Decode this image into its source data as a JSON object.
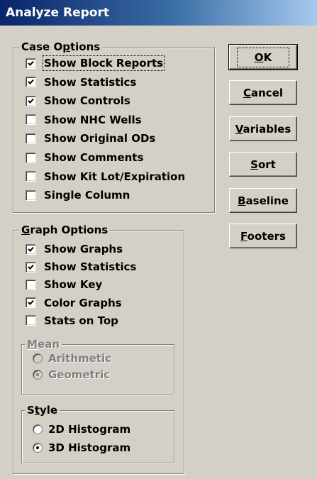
{
  "window": {
    "title": "Analyze Report"
  },
  "case_options": {
    "legend_pre": "Case O",
    "legend_u": "p",
    "legend_post": "tions",
    "items": [
      {
        "label": "Show Block Reports",
        "checked": true
      },
      {
        "label": "Show Statistics",
        "checked": true
      },
      {
        "label": "Show Controls",
        "checked": true
      },
      {
        "label": "Show NHC Wells",
        "checked": false
      },
      {
        "label": "Show Original ODs",
        "checked": false
      },
      {
        "label": "Show Comments",
        "checked": false
      },
      {
        "label": "Show Kit Lot/Expiration",
        "checked": false
      },
      {
        "label": "Single Column",
        "checked": false
      }
    ]
  },
  "graph_options": {
    "legend_u": "G",
    "legend_post": "raph Options",
    "items": [
      {
        "label": "Show Graphs",
        "checked": true
      },
      {
        "label": "Show Statistics",
        "checked": true
      },
      {
        "label": "Show Key",
        "checked": false
      },
      {
        "label": "Color Graphs",
        "checked": true
      },
      {
        "label": "Stats on Top",
        "checked": false
      }
    ],
    "mean": {
      "legend_u": "M",
      "legend_post": "ean",
      "options": [
        {
          "label": "Arithmetic",
          "selected": false
        },
        {
          "label": "Geometric",
          "selected": true
        }
      ]
    },
    "style": {
      "legend_pre": "S",
      "legend_u": "t",
      "legend_post": "yle",
      "options": [
        {
          "label": "2D Histogram",
          "selected": false
        },
        {
          "label": "3D Histogram",
          "selected": true
        }
      ]
    }
  },
  "buttons": {
    "ok": {
      "u": "O",
      "rest": "K"
    },
    "cancel": {
      "u": "C",
      "rest": "ancel"
    },
    "variables": {
      "u": "V",
      "rest": "ariables"
    },
    "sort": {
      "u": "S",
      "rest": "ort"
    },
    "baseline": {
      "u": "B",
      "rest": "aseline"
    },
    "footers": {
      "u": "F",
      "rest": "ooters"
    }
  }
}
